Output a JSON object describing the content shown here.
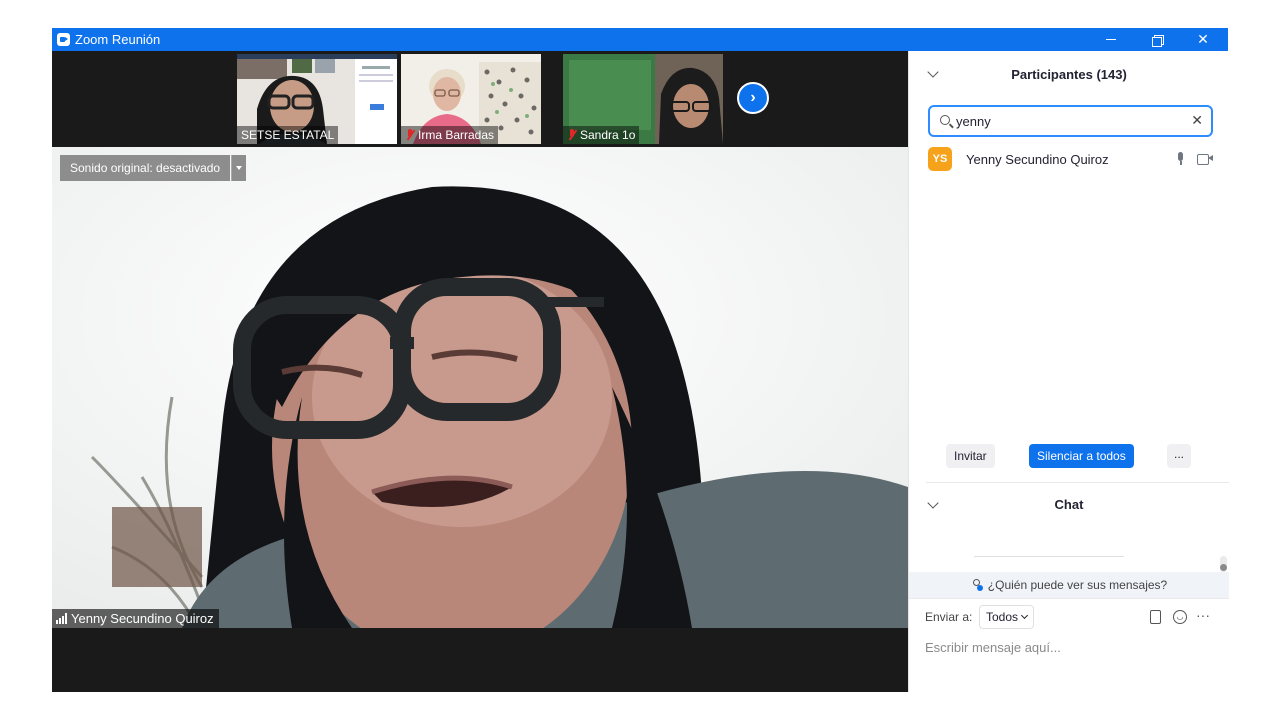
{
  "window": {
    "title": "Zoom Reunión",
    "colors": {
      "titlebar": "#0e72ed",
      "accent": "#0e72ed",
      "avatar": "#f7a21b"
    }
  },
  "gallery_strip": {
    "thumbnails": [
      {
        "name": "SETSE ESTATAL",
        "muted": false
      },
      {
        "name": "Irma Barradas",
        "muted": true
      },
      {
        "name": "Sandra 1o",
        "muted": true
      }
    ],
    "next_icon": "chevron-right-icon"
  },
  "main_video": {
    "sound_button": "Sonido original: desactivado",
    "speaker_name": "Yenny Secundino Quiroz"
  },
  "participants": {
    "title": "Participantes (143)",
    "search_value": "yenny",
    "list": [
      {
        "initials": "YS",
        "name": "Yenny Secundino Quiroz",
        "icons": [
          "mic-icon",
          "video-icon"
        ]
      }
    ],
    "invite_button": "Invitar",
    "mute_all_button": "Silenciar a todos",
    "more_button": "..."
  },
  "chat": {
    "title": "Chat",
    "privacy_text": "¿Quién puede ver sus mensajes?",
    "send_to_label": "Enviar a:",
    "send_to_value": "Todos",
    "input_placeholder": "Escribir mensaje aquí..."
  }
}
